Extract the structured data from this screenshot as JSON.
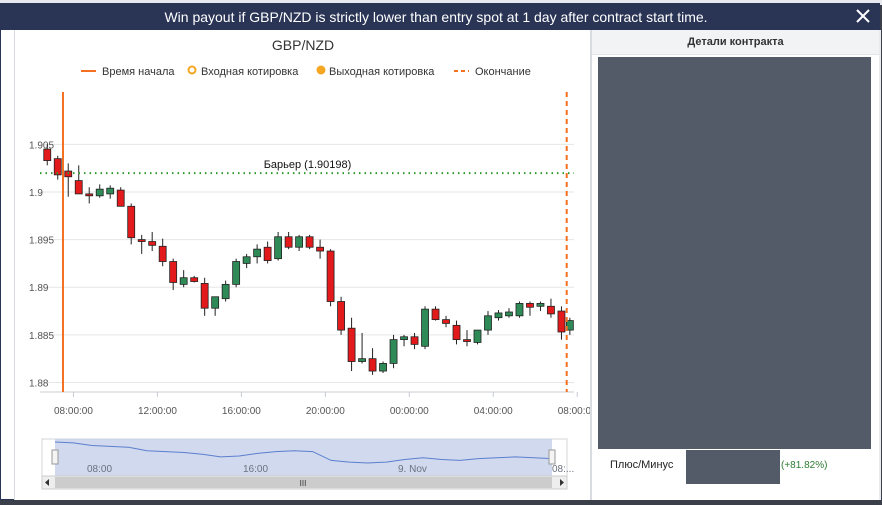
{
  "dialog": {
    "title": "Win payout if GBP/NZD is strictly lower than entry spot at 1 day after contract start time."
  },
  "chart": {
    "title": "GBP/NZD",
    "legend": [
      {
        "label": "Время начала",
        "type": "solid-line",
        "color": "#f37021"
      },
      {
        "label": "Входная котировка",
        "type": "ring",
        "color": "#f5a623"
      },
      {
        "label": "Выходная котировка",
        "type": "dot",
        "color": "#f5a623"
      },
      {
        "label": "Окончание",
        "type": "dashed-line",
        "color": "#f37021"
      }
    ],
    "barrier_label": "Барьер (1.90198)",
    "barrier_value": 1.90198,
    "barrier_color": "#2e9b2e",
    "up_color": "#2e8b57",
    "down_color": "#e31a1c",
    "navigator_labels": [
      "08:00",
      "16:00",
      "9. Nov",
      "08:..."
    ],
    "scroll_thumb_glyph": "III"
  },
  "chart_data": {
    "type": "candlestick",
    "title": "GBP/NZD",
    "xlabel": "",
    "ylabel": "",
    "x_tick_labels": [
      "08:00:00",
      "12:00:00",
      "16:00:00",
      "20:00:00",
      "00:00:00",
      "04:00:00",
      "08:00:00"
    ],
    "y_tick_labels": [
      "1.88",
      "1.885",
      "1.89",
      "1.895",
      "1.9",
      "1.905"
    ],
    "ylim": [
      1.879,
      1.9105
    ],
    "xlim": [
      0,
      50.6
    ],
    "start_time_index": 2,
    "end_time_index": 50,
    "grid": true,
    "candles": [
      {
        "i": 0.5,
        "o": 1.9045,
        "h": 1.905,
        "l": 1.9028,
        "c": 1.9033
      },
      {
        "i": 1.5,
        "o": 1.9035,
        "h": 1.9038,
        "l": 1.9013,
        "c": 1.9018
      },
      {
        "i": 2.5,
        "o": 1.9022,
        "h": 1.903,
        "l": 1.8995,
        "c": 1.9016
      },
      {
        "i": 3.5,
        "o": 1.9012,
        "h": 1.9028,
        "l": 1.8998,
        "c": 1.8998
      },
      {
        "i": 4.5,
        "o": 1.8998,
        "h": 1.9005,
        "l": 1.8988,
        "c": 1.8996
      },
      {
        "i": 5.5,
        "o": 1.8996,
        "h": 1.9008,
        "l": 1.8994,
        "c": 1.9003
      },
      {
        "i": 6.5,
        "o": 1.8998,
        "h": 1.9007,
        "l": 1.8993,
        "c": 1.9004
      },
      {
        "i": 7.5,
        "o": 1.9002,
        "h": 1.9005,
        "l": 1.8985,
        "c": 1.8985
      },
      {
        "i": 8.5,
        "o": 1.8985,
        "h": 1.8988,
        "l": 1.8945,
        "c": 1.8952
      },
      {
        "i": 9.5,
        "o": 1.895,
        "h": 1.8955,
        "l": 1.8935,
        "c": 1.8948
      },
      {
        "i": 10.5,
        "o": 1.8948,
        "h": 1.8958,
        "l": 1.8938,
        "c": 1.8944
      },
      {
        "i": 11.5,
        "o": 1.8943,
        "h": 1.8951,
        "l": 1.8922,
        "c": 1.8927
      },
      {
        "i": 12.5,
        "o": 1.8927,
        "h": 1.893,
        "l": 1.8897,
        "c": 1.8905
      },
      {
        "i": 13.5,
        "o": 1.8903,
        "h": 1.8918,
        "l": 1.89,
        "c": 1.891
      },
      {
        "i": 14.5,
        "o": 1.891,
        "h": 1.8912,
        "l": 1.8905,
        "c": 1.8906
      },
      {
        "i": 15.5,
        "o": 1.8904,
        "h": 1.891,
        "l": 1.887,
        "c": 1.8878
      },
      {
        "i": 16.5,
        "o": 1.8878,
        "h": 1.889,
        "l": 1.887,
        "c": 1.889
      },
      {
        "i": 17.5,
        "o": 1.8888,
        "h": 1.8907,
        "l": 1.8885,
        "c": 1.8903
      },
      {
        "i": 18.5,
        "o": 1.8903,
        "h": 1.893,
        "l": 1.89,
        "c": 1.8927
      },
      {
        "i": 19.5,
        "o": 1.8925,
        "h": 1.8935,
        "l": 1.892,
        "c": 1.8932
      },
      {
        "i": 20.5,
        "o": 1.8932,
        "h": 1.8945,
        "l": 1.8925,
        "c": 1.894
      },
      {
        "i": 21.5,
        "o": 1.8942,
        "h": 1.8948,
        "l": 1.8925,
        "c": 1.8928
      },
      {
        "i": 22.5,
        "o": 1.893,
        "h": 1.8958,
        "l": 1.8928,
        "c": 1.8953
      },
      {
        "i": 23.5,
        "o": 1.8953,
        "h": 1.8958,
        "l": 1.894,
        "c": 1.8942
      },
      {
        "i": 24.5,
        "o": 1.8942,
        "h": 1.8955,
        "l": 1.8938,
        "c": 1.8953
      },
      {
        "i": 25.5,
        "o": 1.8953,
        "h": 1.8955,
        "l": 1.894,
        "c": 1.8942
      },
      {
        "i": 26.5,
        "o": 1.8942,
        "h": 1.895,
        "l": 1.893,
        "c": 1.8938
      },
      {
        "i": 27.5,
        "o": 1.8938,
        "h": 1.894,
        "l": 1.888,
        "c": 1.8885
      },
      {
        "i": 28.5,
        "o": 1.8885,
        "h": 1.889,
        "l": 1.885,
        "c": 1.8855
      },
      {
        "i": 29.5,
        "o": 1.8857,
        "h": 1.8868,
        "l": 1.8812,
        "c": 1.8822
      },
      {
        "i": 30.5,
        "o": 1.8822,
        "h": 1.8852,
        "l": 1.882,
        "c": 1.8825
      },
      {
        "i": 31.5,
        "o": 1.8825,
        "h": 1.8836,
        "l": 1.8808,
        "c": 1.8812
      },
      {
        "i": 32.5,
        "o": 1.8812,
        "h": 1.8822,
        "l": 1.881,
        "c": 1.882
      },
      {
        "i": 33.5,
        "o": 1.882,
        "h": 1.885,
        "l": 1.8815,
        "c": 1.8845
      },
      {
        "i": 34.5,
        "o": 1.8845,
        "h": 1.885,
        "l": 1.8838,
        "c": 1.8848
      },
      {
        "i": 35.5,
        "o": 1.8848,
        "h": 1.8852,
        "l": 1.8835,
        "c": 1.884
      },
      {
        "i": 36.5,
        "o": 1.8838,
        "h": 1.888,
        "l": 1.8835,
        "c": 1.8877
      },
      {
        "i": 37.5,
        "o": 1.8877,
        "h": 1.888,
        "l": 1.8865,
        "c": 1.8866
      },
      {
        "i": 38.5,
        "o": 1.8866,
        "h": 1.887,
        "l": 1.8858,
        "c": 1.8862
      },
      {
        "i": 39.5,
        "o": 1.886,
        "h": 1.8865,
        "l": 1.884,
        "c": 1.8845
      },
      {
        "i": 40.5,
        "o": 1.8845,
        "h": 1.8855,
        "l": 1.8838,
        "c": 1.8843
      },
      {
        "i": 41.5,
        "o": 1.8842,
        "h": 1.8855,
        "l": 1.884,
        "c": 1.8855
      },
      {
        "i": 42.5,
        "o": 1.8855,
        "h": 1.8875,
        "l": 1.885,
        "c": 1.887
      },
      {
        "i": 43.5,
        "o": 1.8868,
        "h": 1.8876,
        "l": 1.8865,
        "c": 1.8873
      },
      {
        "i": 44.5,
        "o": 1.887,
        "h": 1.8878,
        "l": 1.8868,
        "c": 1.8874
      },
      {
        "i": 45.5,
        "o": 1.887,
        "h": 1.8885,
        "l": 1.8868,
        "c": 1.8883
      },
      {
        "i": 46.5,
        "o": 1.8883,
        "h": 1.8885,
        "l": 1.887,
        "c": 1.8879
      },
      {
        "i": 47.5,
        "o": 1.888,
        "h": 1.8885,
        "l": 1.8875,
        "c": 1.8883
      },
      {
        "i": 48.5,
        "o": 1.888,
        "h": 1.8888,
        "l": 1.8868,
        "c": 1.8872
      },
      {
        "i": 49.5,
        "o": 1.8875,
        "h": 1.888,
        "l": 1.8845,
        "c": 1.8853
      },
      {
        "i": 50.3,
        "o": 1.8855,
        "h": 1.8868,
        "l": 1.885,
        "c": 1.8865
      }
    ],
    "navigator_series": [
      1.905,
      1.904,
      1.901,
      1.9,
      1.899,
      1.895,
      1.894,
      1.893,
      1.891,
      1.888,
      1.889,
      1.892,
      1.894,
      1.895,
      1.894,
      1.884,
      1.882,
      1.881,
      1.882,
      1.885,
      1.887,
      1.885,
      1.884,
      1.886,
      1.887,
      1.888,
      1.887,
      1.886
    ]
  },
  "details": {
    "header": "Детали контракта",
    "rows": [
      {
        "label": "Плюс/Минус",
        "value": "(+81.82%)",
        "value_color": "#2e7d32"
      }
    ]
  }
}
